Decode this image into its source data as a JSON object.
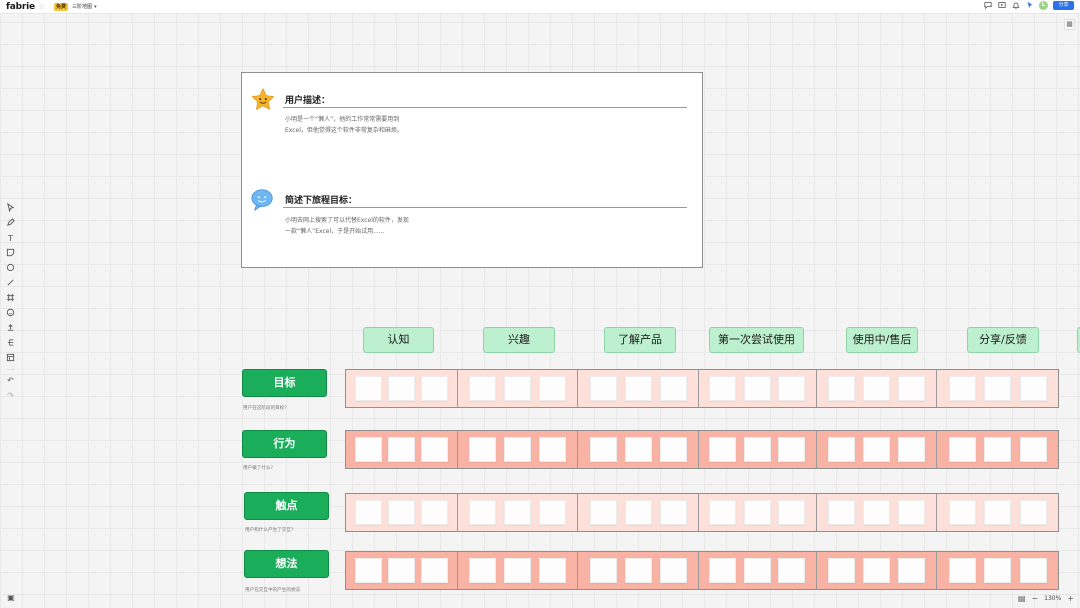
{
  "app": {
    "logo": "fabrie",
    "badge": "免费",
    "doc_title": "三阶地图",
    "share_label": "分享",
    "avatar_letter": "L",
    "zoom": "130%"
  },
  "colors": {
    "row_label_green": "#1aae5b",
    "stage_mint": "#bdf0cf",
    "light_salmon": "#fde0d9",
    "salmon": "#f9b3a4",
    "share_blue": "#2b72e6"
  },
  "intro": {
    "user_heading": "用户描述：",
    "user_body_1": "小明是一个“懒人”，他的工作常常需要用到",
    "user_body_2": "Excel，但他觉得这个软件非常复杂和麻烦。",
    "goal_heading": "简述下旅程目标：",
    "goal_body_1": "小明去网上搜索了可以代替Excel的软件，发现",
    "goal_body_2": "一款“懒人”Excel，于是开始试用......"
  },
  "stages": [
    "认知",
    "兴趣",
    "了解产品",
    "第一次尝试使用",
    "使用中/售后",
    "分享/反馈"
  ],
  "rows": [
    {
      "label": "目标",
      "desc": "用户在这阶段的目标?"
    },
    {
      "label": "行为",
      "desc": "用户做了什么?"
    },
    {
      "label": "触点",
      "desc": "用户和什么产生了交互?"
    },
    {
      "label": "想法",
      "desc": "用户在交互中的产生的想法"
    }
  ],
  "icons": {
    "top_right": [
      "comment-icon",
      "present-icon",
      "bell-icon",
      "cursor-icon"
    ],
    "toolbar": [
      "select-icon",
      "pen-icon",
      "text-icon",
      "sticky-note-icon",
      "shape-icon",
      "line-icon",
      "frame-icon",
      "sticker-icon",
      "upload-icon",
      "mindmap-icon",
      "template-icon",
      "undo-icon",
      "redo-icon"
    ]
  }
}
